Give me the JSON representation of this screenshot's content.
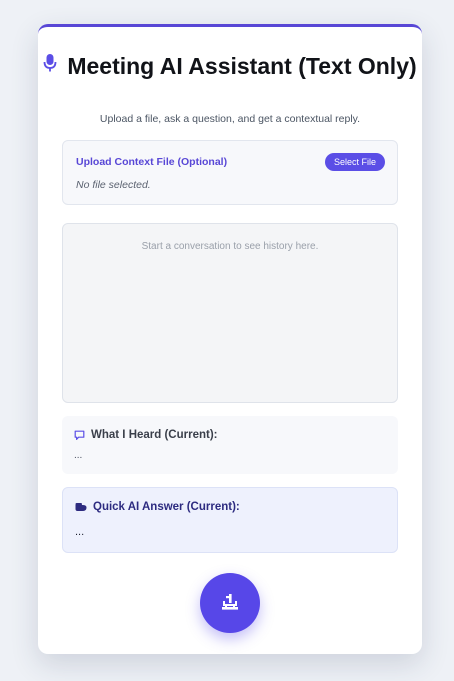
{
  "app": {
    "title": "Meeting AI Assistant (Text Only)",
    "subtitle": "Upload a file, ask a question, and get a contextual reply."
  },
  "upload": {
    "label": "Upload Context File (Optional)",
    "button_label": "Select File",
    "status": "No file selected."
  },
  "history": {
    "empty_text": "Start a conversation to see history here."
  },
  "heard": {
    "title": "What I Heard (Current):",
    "content": "..."
  },
  "answer": {
    "title": "Quick AI Answer (Current):",
    "content": "..."
  },
  "icons": {
    "title": "microphone-icon",
    "heard": "speech-bubble-icon",
    "answer": "pointing-hand-icon",
    "record": "record-button-icon"
  },
  "colors": {
    "accent": "#5847d6",
    "button": "#5b4ee6",
    "record": "#5747e8"
  }
}
